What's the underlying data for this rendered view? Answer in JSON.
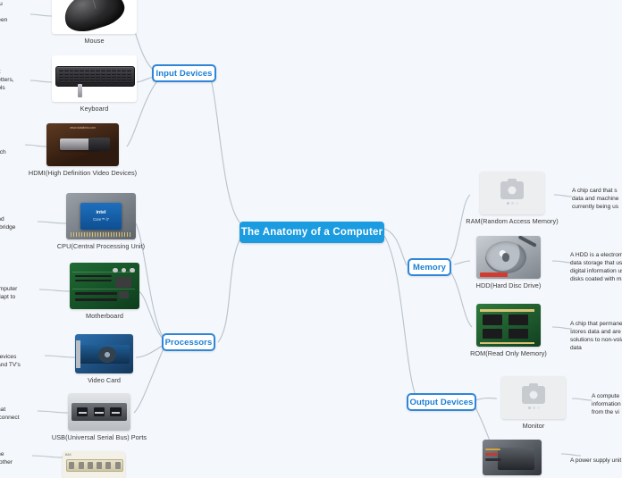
{
  "diagram": {
    "type": "mindmap",
    "background_color": "#f4f7fb",
    "root": {
      "label": "The Anatomy of a Computer",
      "fill": "#1b9be0",
      "text_color": "#ffffff"
    },
    "branch_style": {
      "fill": "#ffffff",
      "border_color": "#2f86d8",
      "text_color": "#1b7fd4"
    },
    "branches": [
      {
        "label": "Input Devices"
      },
      {
        "label": "Processors"
      },
      {
        "label": "Memory"
      },
      {
        "label": "Output Devices"
      }
    ],
    "leaves": [
      {
        "caption": "Mouse",
        "icon": "mouse-photo"
      },
      {
        "caption": "Keyboard",
        "icon": "keyboard-photo"
      },
      {
        "caption": "HDMI(High Definition Video Devices)",
        "icon": "hdmi-photo"
      },
      {
        "caption": "CPU(Central Processing Unit)",
        "icon": "cpu-photo"
      },
      {
        "caption": "Motherboard",
        "icon": "motherboard-photo"
      },
      {
        "caption": "Video Card",
        "icon": "videocard-photo"
      },
      {
        "caption": "USB(Universal Serial Bus) Ports",
        "icon": "usb-photo"
      },
      {
        "caption": "RAM(Random Access Memory)",
        "icon": "ram-placeholder"
      },
      {
        "caption": "HDD(Hard Disc Drive)",
        "icon": "hdd-photo"
      },
      {
        "caption": "ROM(Read Only Memory)",
        "icon": "rom-photo"
      },
      {
        "caption": "Monitor",
        "icon": "monitor-placeholder"
      }
    ],
    "notes": [
      {
        "id": "mouse-note",
        "text": "allows you\non the\nn the screen\ndifferent"
      },
      {
        "id": "keyboard-note",
        "text": "vice that\nto use letters,\nd symbols"
      },
      {
        "id": "hdmi-note",
        "text": "t\nd\nuch"
      },
      {
        "id": "cpu-note",
        "text": "mputer,\nrations and\nthe Northbridge"
      },
      {
        "id": "motherboard-note",
        "text": "is basically\nn of the computer\nponents adapt to"
      },
      {
        "id": "videocard-note",
        "text": "onsible to\nisplay to devices\nrojectors and TV's"
      },
      {
        "id": "usb-note",
        "text": "rts that\ns to connect"
      },
      {
        "id": "connector-note",
        "text": "m the\nthe other"
      },
      {
        "id": "ram-note",
        "text": "A chip card that s\ndata and machine\ncurrently being us"
      },
      {
        "id": "hdd-note",
        "text": "A HDD is a electrome\ndata storage that use\ndigital information us\ndisks coated with ma"
      },
      {
        "id": "rom-note",
        "text": "A chip that permanen\nstores data and are t\nsolutions to non-vola\ndata"
      },
      {
        "id": "monitor-note",
        "text": "A compute\ninformation\nfrom the vi"
      },
      {
        "id": "psu-note",
        "text": "A power supply unit"
      }
    ],
    "hdmi_watermark": "www.datalinks.com",
    "cpu_brand": "intel",
    "cpu_model": "Core™ i7",
    "connector_label": "MAX"
  }
}
